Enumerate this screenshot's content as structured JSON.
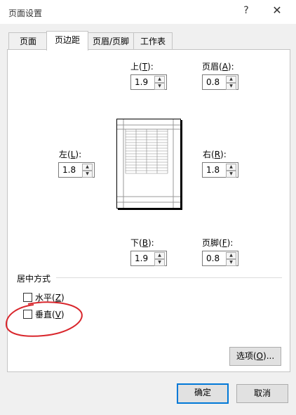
{
  "window": {
    "title": "页面设置",
    "help_glyph": "?",
    "close_glyph": "✕",
    "close_icon": "close-icon"
  },
  "tabs": [
    {
      "label": "页面",
      "active": false
    },
    {
      "label": "页边距",
      "active": true
    },
    {
      "label": "页眉/页脚",
      "active": false
    },
    {
      "label": "工作表",
      "active": false
    }
  ],
  "margins": {
    "top": {
      "label": "上",
      "key": "T",
      "value": "1.9"
    },
    "header": {
      "label": "页眉",
      "key": "A",
      "value": "0.8"
    },
    "left": {
      "label": "左",
      "key": "L",
      "value": "1.8"
    },
    "right": {
      "label": "右",
      "key": "R",
      "value": "1.8"
    },
    "bottom": {
      "label": "下",
      "key": "B",
      "value": "1.9"
    },
    "footer": {
      "label": "页脚",
      "key": "F",
      "value": "0.8"
    }
  },
  "centering": {
    "title": "居中方式",
    "horizontal": {
      "label": "水平",
      "key": "Z",
      "checked": false
    },
    "vertical": {
      "label": "垂直",
      "key": "V",
      "checked": false
    }
  },
  "buttons": {
    "options": {
      "label": "选项",
      "key": "O",
      "suffix": "..."
    },
    "ok": "确定",
    "cancel": "取消"
  },
  "colors": {
    "annotation_red": "#d9262c",
    "default_button_border": "#0078d7"
  }
}
